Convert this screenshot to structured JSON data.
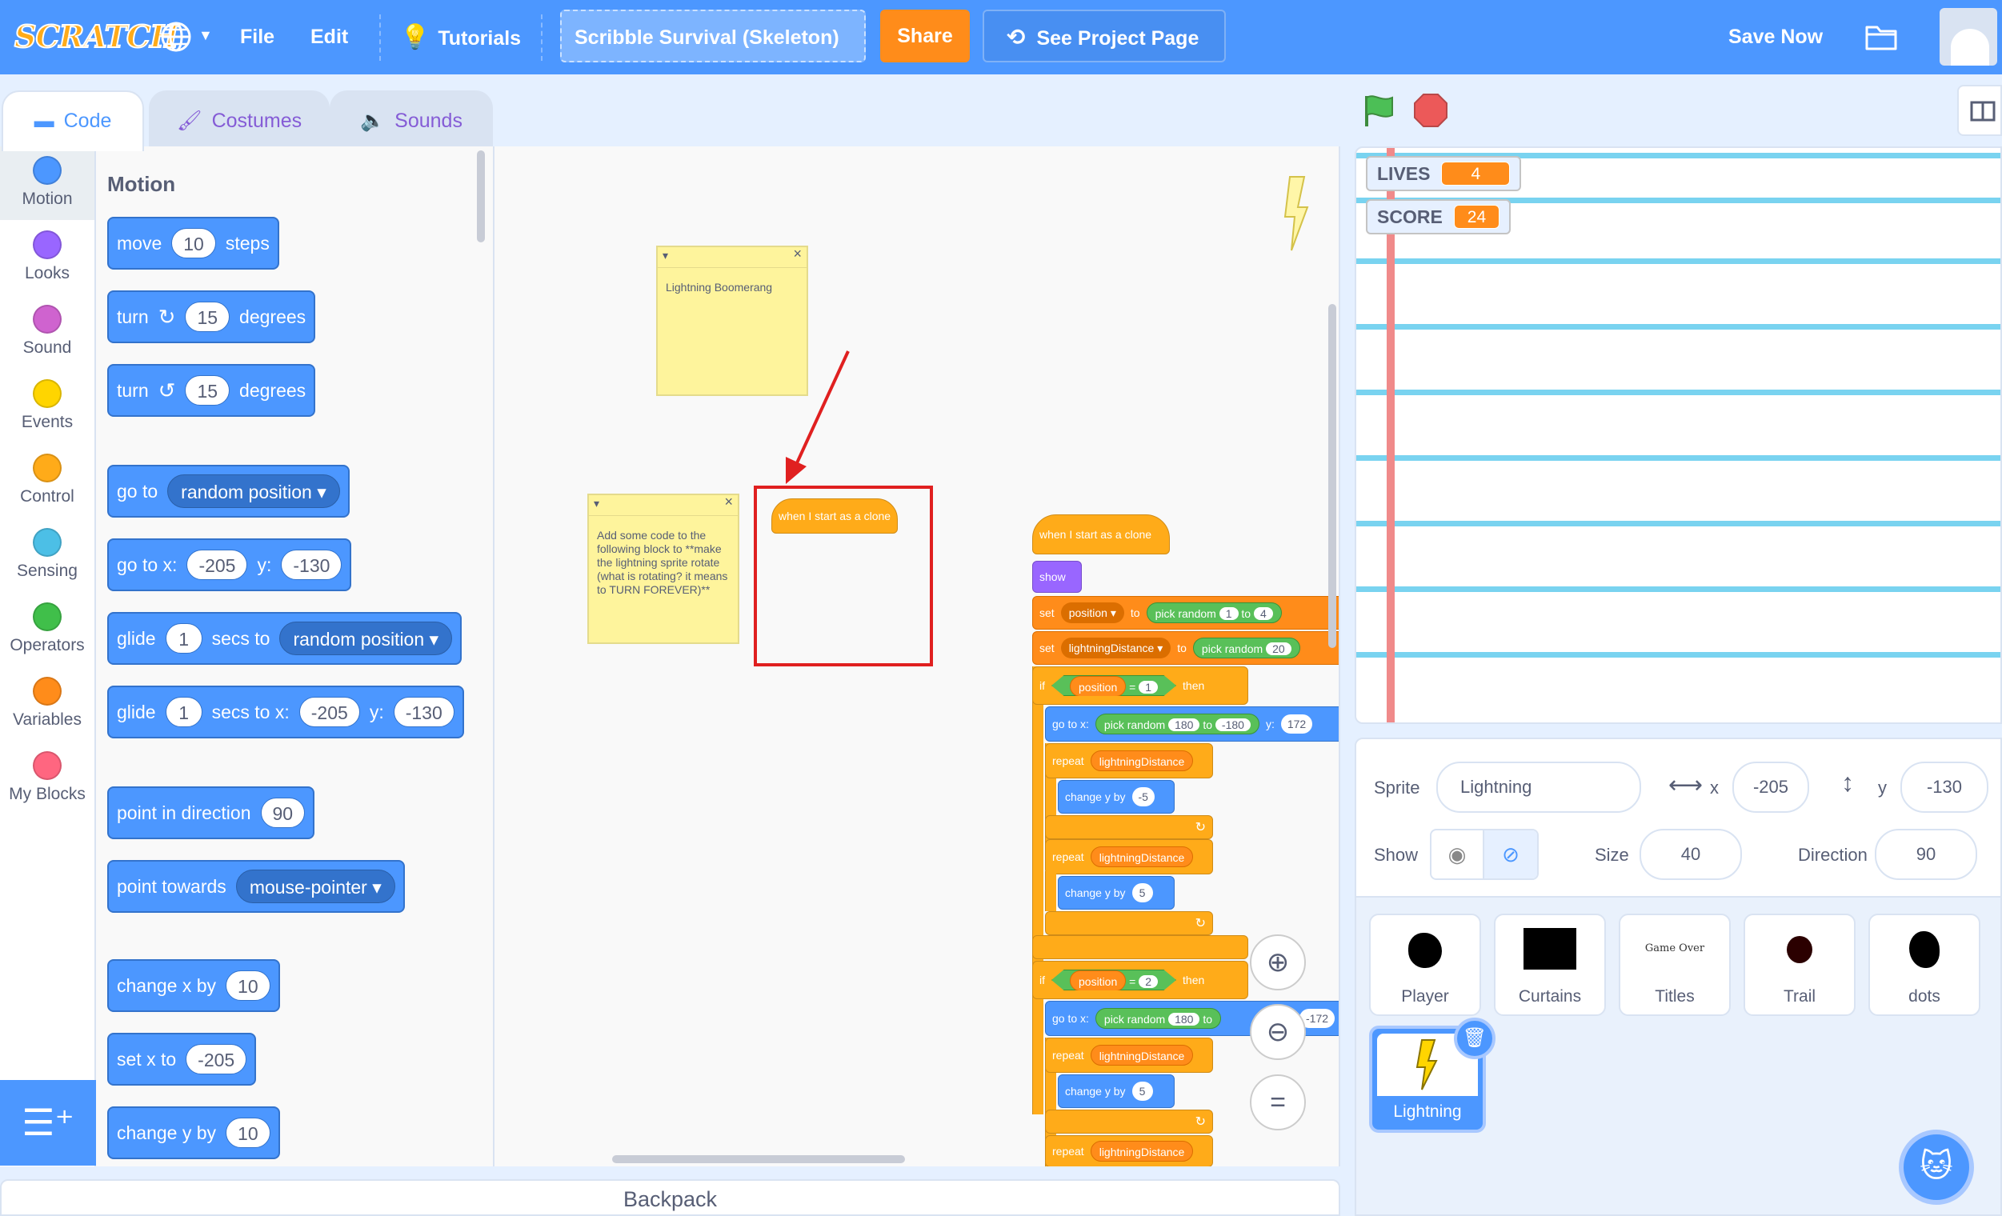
{
  "menu": {
    "logo": "SCRATCH",
    "globe_icon": "globe-icon",
    "file": "File",
    "edit": "Edit",
    "tutorials": "Tutorials",
    "project_title": "Scribble Survival (Skeleton)",
    "share": "Share",
    "see_project": "See Project Page",
    "save_now": "Save Now"
  },
  "tabs": {
    "code": "Code",
    "costumes": "Costumes",
    "sounds": "Sounds"
  },
  "categories": [
    {
      "label": "Motion",
      "color": "#4c97ff"
    },
    {
      "label": "Looks",
      "color": "#9966ff"
    },
    {
      "label": "Sound",
      "color": "#cf63cf"
    },
    {
      "label": "Events",
      "color": "#ffd500"
    },
    {
      "label": "Control",
      "color": "#ffab19"
    },
    {
      "label": "Sensing",
      "color": "#4cbfe6"
    },
    {
      "label": "Operators",
      "color": "#40bf4a"
    },
    {
      "label": "Variables",
      "color": "#ff8c1a"
    },
    {
      "label": "My Blocks",
      "color": "#ff6680"
    }
  ],
  "palette": {
    "title": "Motion",
    "move": {
      "a": "move",
      "v": "10",
      "b": "steps"
    },
    "turn_cw": {
      "a": "turn",
      "v": "15",
      "b": "degrees"
    },
    "turn_ccw": {
      "a": "turn",
      "v": "15",
      "b": "degrees"
    },
    "goto": {
      "a": "go to",
      "dd": "random position"
    },
    "gotoxy": {
      "a": "go to x:",
      "x": "-205",
      "b": "y:",
      "y": "-130"
    },
    "glide": {
      "a": "glide",
      "v": "1",
      "b": "secs to",
      "dd": "random position"
    },
    "glidexy": {
      "a": "glide",
      "v": "1",
      "b": "secs to x:",
      "x": "-205",
      "c": "y:",
      "y": "-130"
    },
    "point": {
      "a": "point in direction",
      "v": "90"
    },
    "towards": {
      "a": "point towards",
      "dd": "mouse-pointer"
    },
    "changex": {
      "a": "change x by",
      "v": "10"
    },
    "setx": {
      "a": "set x to",
      "v": "-205"
    },
    "changey": {
      "a": "change y by",
      "v": "10"
    }
  },
  "workspace": {
    "note1": "Lightning Boomerang",
    "note2": "Add some code to the following block to **make the lightning sprite rotate (what is rotating? it means to TURN FOREVER)**",
    "hat1": "when I start as a clone",
    "script": {
      "hat": "when I start as a clone",
      "show": "show",
      "set": "set",
      "to": "to",
      "position_var": "position",
      "distance_var": "lightningDistance",
      "pick_random": "pick random",
      "r1_from": "1",
      "r1_to": "4",
      "r2_from": "20",
      "if": "if",
      "then": "then",
      "eq": "=",
      "cond1": "1",
      "cond2": "2",
      "goto_x": "go to x:",
      "y_label": "y:",
      "gx_from": "180",
      "gx_to": "-180",
      "gy": "172",
      "gy2": "-172",
      "repeat": "repeat",
      "changey": "change y by",
      "cy1": "-5",
      "cy2": "5",
      "cy3": "5"
    }
  },
  "backpack": "Backpack",
  "stage": {
    "lives_label": "LIVES",
    "lives_value": "4",
    "score_label": "SCORE",
    "score_value": "24"
  },
  "sprite_info": {
    "sprite_label": "Sprite",
    "sprite_name": "Lightning",
    "x_label": "x",
    "x_value": "-205",
    "y_label": "y",
    "y_value": "-130",
    "show_label": "Show",
    "size_label": "Size",
    "size_value": "40",
    "direction_label": "Direction",
    "direction_value": "90"
  },
  "sprites": [
    "Player",
    "Curtains",
    "Titles",
    "Trail",
    "dots",
    "Lightning"
  ],
  "titles_thumb_text": "Game Over",
  "colors": {
    "accent": "#4c97ff",
    "share": "#ff8c1a",
    "highlight": "#e02020"
  }
}
